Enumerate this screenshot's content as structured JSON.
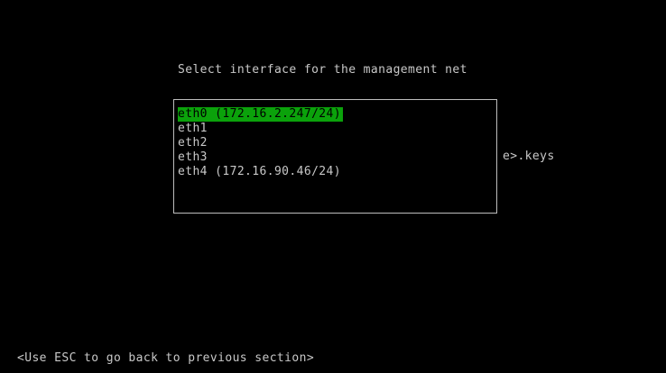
{
  "dialog": {
    "title": "Select interface for the management net",
    "interfaces": [
      {
        "label": "eth0 (172.16.2.247/24)",
        "selected": true
      },
      {
        "label": "eth1",
        "selected": false
      },
      {
        "label": "eth2",
        "selected": false
      },
      {
        "label": "eth3",
        "selected": false
      },
      {
        "label": "eth4 (172.16.90.46/24)",
        "selected": false
      }
    ],
    "side_fragment": "e>.keys"
  },
  "footer": {
    "hint": "<Use ESC to go back to previous section>"
  },
  "colors": {
    "background": "#000000",
    "text": "#c8c8c8",
    "selection": "#0ba20b",
    "border": "#bdbdbd"
  }
}
